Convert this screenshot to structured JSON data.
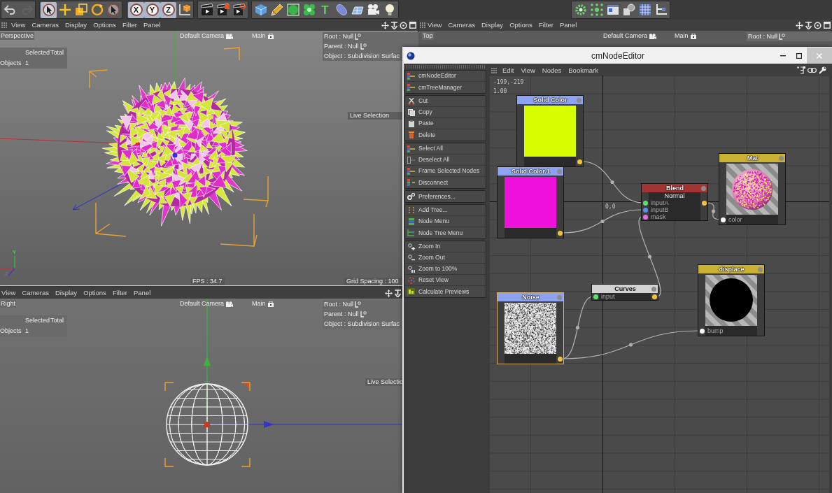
{
  "toolbar": {
    "groups": [
      {
        "buttons": [
          {
            "kind": "undo",
            "disabled": false
          },
          {
            "kind": "redo",
            "disabled": true
          }
        ]
      },
      {
        "buttons": [
          {
            "kind": "live-selection",
            "selected": true
          },
          {
            "kind": "move",
            "selected": false
          },
          {
            "kind": "scale",
            "selected": false
          },
          {
            "kind": "rotate",
            "selected": false
          },
          {
            "kind": "recent-tool",
            "selected": false
          }
        ]
      },
      {
        "buttons": [
          {
            "kind": "axis",
            "label": "X",
            "on": true
          },
          {
            "kind": "axis",
            "label": "Y",
            "on": true
          },
          {
            "kind": "axis",
            "label": "Z",
            "on": true
          },
          {
            "kind": "coordinates"
          }
        ]
      },
      {
        "buttons": [
          {
            "kind": "render-view"
          },
          {
            "kind": "render-picture"
          },
          {
            "kind": "render-settings"
          }
        ]
      },
      {
        "buttons": [
          {
            "kind": "cube"
          },
          {
            "kind": "pen"
          },
          {
            "kind": "subdivision"
          },
          {
            "kind": "cloner"
          },
          {
            "kind": "text",
            "label": "T"
          },
          {
            "kind": "deformer"
          },
          {
            "kind": "floor"
          },
          {
            "kind": "camera"
          },
          {
            "kind": "light"
          }
        ]
      },
      {
        "buttons": [
          {
            "kind": "workplane"
          },
          {
            "kind": "snap"
          },
          {
            "kind": "texture"
          },
          {
            "kind": "objects"
          },
          {
            "kind": "grid"
          },
          {
            "kind": "axis-mode"
          }
        ]
      }
    ]
  },
  "viewports": [
    {
      "kind": "perspective",
      "menu": [
        "View",
        "Cameras",
        "Display",
        "Options",
        "Filter",
        "Panel"
      ],
      "name": "Perspective",
      "camera": "Default Camera",
      "layer": "Main",
      "info": [
        {
          "kind": "null",
          "label": "Root : Null"
        },
        {
          "kind": "null",
          "label": "Parent : Null"
        },
        {
          "kind": "plain",
          "label": "Object : Subdivision Surfac"
        }
      ],
      "stats": {
        "columns": [
          "Selected",
          "Total"
        ],
        "rows": [
          {
            "label": "Objects",
            "values": [
              "1"
            ]
          }
        ]
      },
      "tool": "Live Selection",
      "fps": "FPS : 34.7",
      "grid_spacing": "Grid Spacing : 100",
      "axis_labels": [
        "Y",
        "Z"
      ]
    },
    {
      "kind": "top",
      "menu": [
        "View",
        "Cameras",
        "Display",
        "Options",
        "Filter",
        "Panel"
      ],
      "name": "Top",
      "camera": "Default Camera",
      "layer": "Main",
      "info": [
        {
          "kind": "null",
          "label": "Root : Null"
        }
      ]
    },
    {
      "kind": "right",
      "menu": [
        "View",
        "Cameras",
        "Display",
        "Options",
        "Filter",
        "Panel"
      ],
      "name": "Right",
      "camera": "Default Camera",
      "layer": "Main",
      "info": [
        {
          "kind": "null",
          "label": "Root : Null"
        },
        {
          "kind": "null",
          "label": "Parent : Null"
        },
        {
          "kind": "plain",
          "label": "Object : Subdivision Surfac"
        }
      ],
      "stats": {
        "columns": [
          "Selected",
          "Total"
        ],
        "rows": [
          {
            "label": "Objects",
            "values": [
              "1"
            ]
          }
        ]
      },
      "tool": "Live Selectio"
    }
  ],
  "node_editor": {
    "title": "cmNodeEditor",
    "sidebar": {
      "groups": [
        {
          "items": [
            {
              "kind": "node-editor",
              "label": "cmNodeEditor"
            },
            {
              "kind": "tree-manager",
              "label": "cmTreeManager"
            }
          ]
        },
        {
          "items": [
            {
              "kind": "cut",
              "label": "Cut"
            },
            {
              "kind": "copy",
              "label": "Copy"
            },
            {
              "kind": "paste",
              "label": "Paste"
            },
            {
              "kind": "delete",
              "label": "Delete"
            }
          ]
        },
        {
          "items": [
            {
              "kind": "select-all",
              "label": "Select All"
            },
            {
              "kind": "deselect-all",
              "label": "Deselect All"
            },
            {
              "kind": "frame-selected",
              "label": "Frame Selected Nodes"
            },
            {
              "kind": "disconnect",
              "label": "Disconnect"
            }
          ]
        },
        {
          "items": [
            {
              "kind": "preferences",
              "label": "Preferences..."
            }
          ]
        },
        {
          "items": [
            {
              "kind": "add-tree",
              "label": "Add Tree..."
            },
            {
              "kind": "node-menu",
              "label": "Node Menu"
            },
            {
              "kind": "node-tree-menu",
              "label": "Node Tree Menu"
            }
          ]
        },
        {
          "items": [
            {
              "kind": "zoom-in",
              "label": "Zoom In"
            },
            {
              "kind": "zoom-out",
              "label": "Zoom Out"
            },
            {
              "kind": "zoom-100",
              "label": "Zoom to 100%"
            },
            {
              "kind": "reset-view",
              "label": "Reset View"
            },
            {
              "kind": "calculate",
              "label": "Calculate Previews"
            }
          ]
        }
      ]
    },
    "menu": [
      "Edit",
      "View",
      "Nodes",
      "Bookmark"
    ],
    "canvas": {
      "position": "-199,-219",
      "zoom": "1.00",
      "origin": "0,0"
    },
    "nodes": [
      {
        "title": "Solid Color",
        "color": "#8ea2f2",
        "selected": false,
        "preview": {
          "kind": "swatch",
          "color": "#d8ff00"
        },
        "output": {
          "color": "#f2c33a"
        }
      },
      {
        "title": "Solid Color.1",
        "color": "#8ea2f2",
        "selected": false,
        "preview": {
          "kind": "swatch",
          "color": "#f010dc"
        },
        "output": {
          "color": "#f2c33a"
        }
      },
      {
        "title": "Blend",
        "color": "#a33434",
        "selected": false,
        "subtitle": "Normal",
        "inputs": [
          {
            "label": "inputA",
            "color": "#5ee06a"
          },
          {
            "label": "inputB",
            "color": "#5c8cf0"
          },
          {
            "label": "mask",
            "color": "#e070e8"
          }
        ],
        "output": {
          "color": "#f2c33a"
        }
      },
      {
        "title": "Mat",
        "color": "#c9b232",
        "selected": false,
        "preview": {
          "kind": "sphere"
        },
        "inputs": [
          {
            "label": "color",
            "color": "#ffffff"
          }
        ]
      },
      {
        "title": "Noise",
        "color": "#8ea2f2",
        "selected": true,
        "preview": {
          "kind": "noise"
        },
        "output": {
          "color": "#f2c33a"
        }
      },
      {
        "title": "Curves",
        "color": "#d2d2d2",
        "selected": false,
        "inputs": [
          {
            "label": "input",
            "color": "#5ee06a"
          }
        ],
        "output": {
          "color": "#f2c33a"
        }
      },
      {
        "title": "displace",
        "color": "#c9b232",
        "selected": false,
        "preview": {
          "kind": "disc"
        },
        "inputs": [
          {
            "label": "bump",
            "color": "#ffffff"
          }
        ]
      }
    ]
  }
}
